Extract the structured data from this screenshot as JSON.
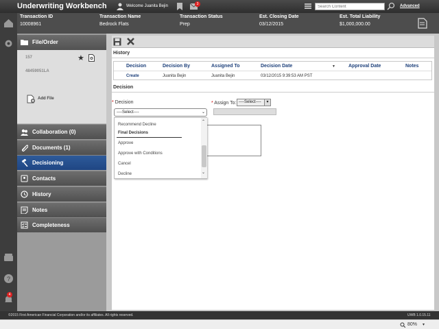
{
  "app": {
    "title": "Underwriting Workbench"
  },
  "topbar": {
    "welcome": "Welcome Juanita Bejin",
    "mail_count": "3",
    "search_placeholder": "Search Content",
    "advanced": "Advanced"
  },
  "transaction": {
    "id_label": "Transaction ID",
    "id_value": "10008961",
    "name_label": "Transaction Name",
    "name_value": "Bedrock Flats",
    "status_label": "Transaction Status",
    "status_value": "Prep",
    "closing_label": "Est. Closing Date",
    "closing_value": "03/12/2015",
    "liability_label": "Est. Total Liability",
    "liability_value": "$1,000,000.00"
  },
  "rail": {
    "notification_count": "4"
  },
  "nav": {
    "file_order": "File/Order",
    "file_number": "157",
    "order_number": "48459051LA",
    "add_file": "Add File",
    "items": [
      {
        "label": "Collaboration (0)",
        "icon": "people-icon"
      },
      {
        "label": "Documents (1)",
        "icon": "paperclip-icon"
      },
      {
        "label": "Decisioning",
        "icon": "gavel-icon",
        "active": true
      },
      {
        "label": "Contacts",
        "icon": "contacts-icon"
      },
      {
        "label": "History",
        "icon": "clock-icon"
      },
      {
        "label": "Notes",
        "icon": "notes-icon"
      },
      {
        "label": "Completeness",
        "icon": "checklist-icon"
      }
    ]
  },
  "history": {
    "title": "History",
    "columns": [
      "Decision",
      "Decision By",
      "Assigned To",
      "Decision Date",
      "Approval Date",
      "Notes"
    ],
    "rows": [
      {
        "decision": "Create",
        "by": "Juanita Bejin",
        "assigned": "Juanita Bejin",
        "date": "03/12/2015 9:39:53 AM PST",
        "approval": "",
        "notes": ""
      }
    ]
  },
  "decision": {
    "title": "Decision",
    "decision_label": "Decision",
    "decision_value": "----Select----",
    "assign_label": "Assign To:",
    "assign_value": "----Select----",
    "options": {
      "recommend_decline": "Recommend Decline",
      "group_final": "Final Decisions",
      "approve": "Approve",
      "approve_conditions": "Approve with Conditions",
      "cancel": "Cancel",
      "decline": "Decline"
    }
  },
  "footer": {
    "copyright": "©2015 First American Financial Corporation and/or its affiliates. All rights reserved.",
    "version": "UWB 1.0.15.11"
  },
  "status": {
    "zoom": "80%"
  },
  "colors": {
    "accent": "#1f4683",
    "dark": "#3d3d3d",
    "badge": "#dd2222"
  }
}
